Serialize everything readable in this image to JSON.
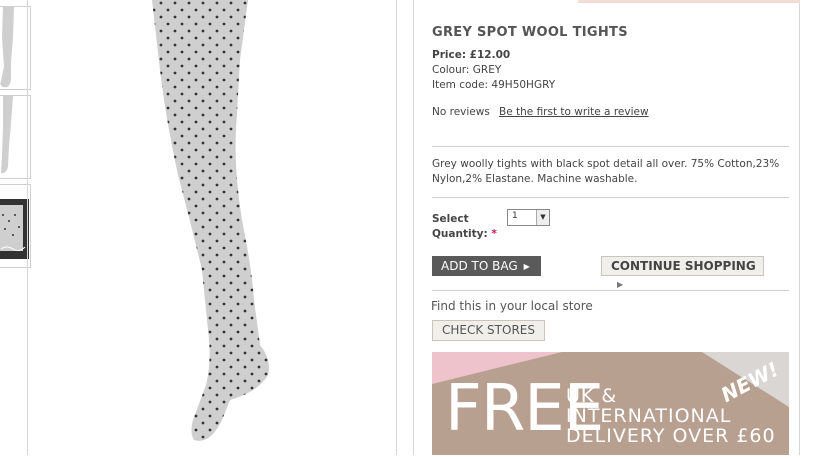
{
  "product": {
    "title": "GREY SPOT WOOL TIGHTS",
    "price_label": "Price: £12.00",
    "colour_label": "Colour: GREY",
    "item_code_label": "Item code: 49H50HGRY",
    "reviews_text": "No reviews",
    "write_review_link": "Be the first to write a review",
    "description": "Grey woolly tights with black spot detail all over. 75% Cotton,23% Nylon,2% Elastane. Machine washable."
  },
  "quantity": {
    "label_line1": "Select",
    "label_line2": "Quantity:",
    "required_mark": "*",
    "selected": "1"
  },
  "actions": {
    "add_to_bag": "ADD TO BAG",
    "continue_shopping": "CONTINUE SHOPPING"
  },
  "store": {
    "find_text": "Find this in your local store",
    "check_stores": "CHECK STORES"
  },
  "banner": {
    "free": "FREE",
    "line1": "UK &",
    "line2": "INTERNATIONAL",
    "line3": "DELIVERY OVER £60",
    "badge": "NEW!"
  },
  "colors": {
    "banner_pink": "#eec3cb",
    "banner_taupe": "#b8a090",
    "button_dark": "#5a5a5a",
    "required": "#d1105c"
  }
}
